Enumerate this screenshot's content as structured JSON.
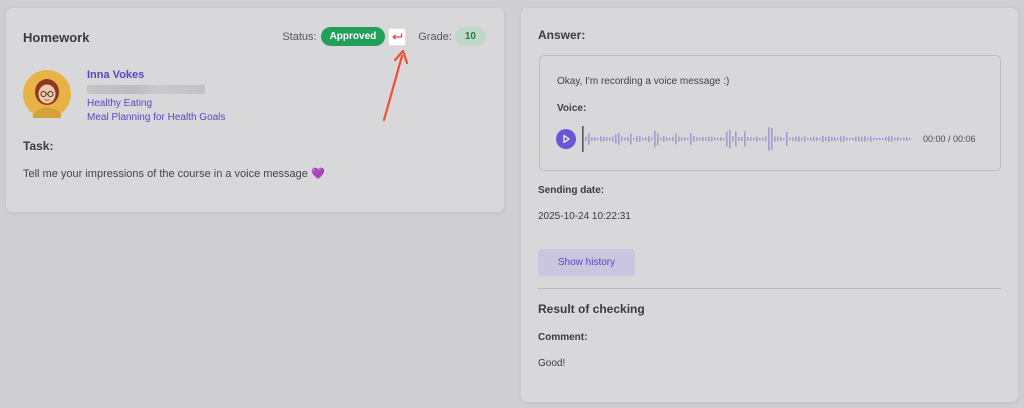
{
  "homework": {
    "title": "Homework",
    "status_label": "Status:",
    "status_value": "Approved",
    "grade_label": "Grade:",
    "grade_value": "10",
    "student_name": "Inna Vokes",
    "course": "Healthy Eating",
    "lesson": "Meal Planning for Health Goals",
    "task_title": "Task:",
    "task_text": "Tell me your impressions of the course in a voice message 💜"
  },
  "answer": {
    "title": "Answer:",
    "text": "Okay, I'm recording a voice message :)",
    "voice_label": "Voice:",
    "time": "00:00 / 00:06",
    "sending_date_label": "Sending date:",
    "sending_date": "2025-10-24 10:22:31",
    "show_history": "Show history"
  },
  "result": {
    "title": "Result of checking",
    "comment_label": "Comment:",
    "comment": "Good!"
  },
  "colors": {
    "accent": "#5a45c8",
    "approved": "#22a05a",
    "annotation_arrow": "#f0502e"
  },
  "icons": [
    "undo-icon",
    "play-icon",
    "avatar-image"
  ]
}
